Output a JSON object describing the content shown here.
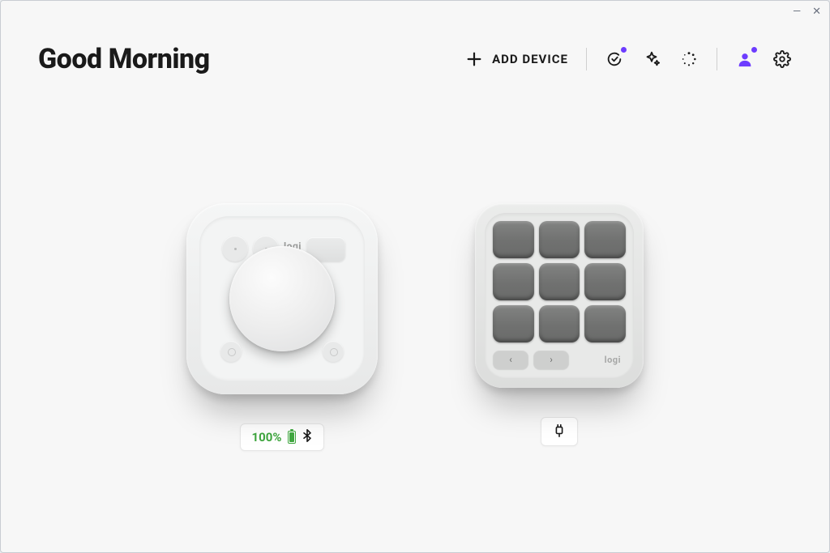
{
  "greeting": "Good Morning",
  "toolbar": {
    "add_device_label": "ADD DEVICE"
  },
  "devices": [
    {
      "type": "dial",
      "brand": "logi",
      "battery_percent": "100%",
      "connection": "bluetooth"
    },
    {
      "type": "keypad",
      "brand": "logi",
      "connection": "wired"
    }
  ],
  "colors": {
    "accent": "#6d3cff",
    "battery_ok": "#3fa63f"
  }
}
